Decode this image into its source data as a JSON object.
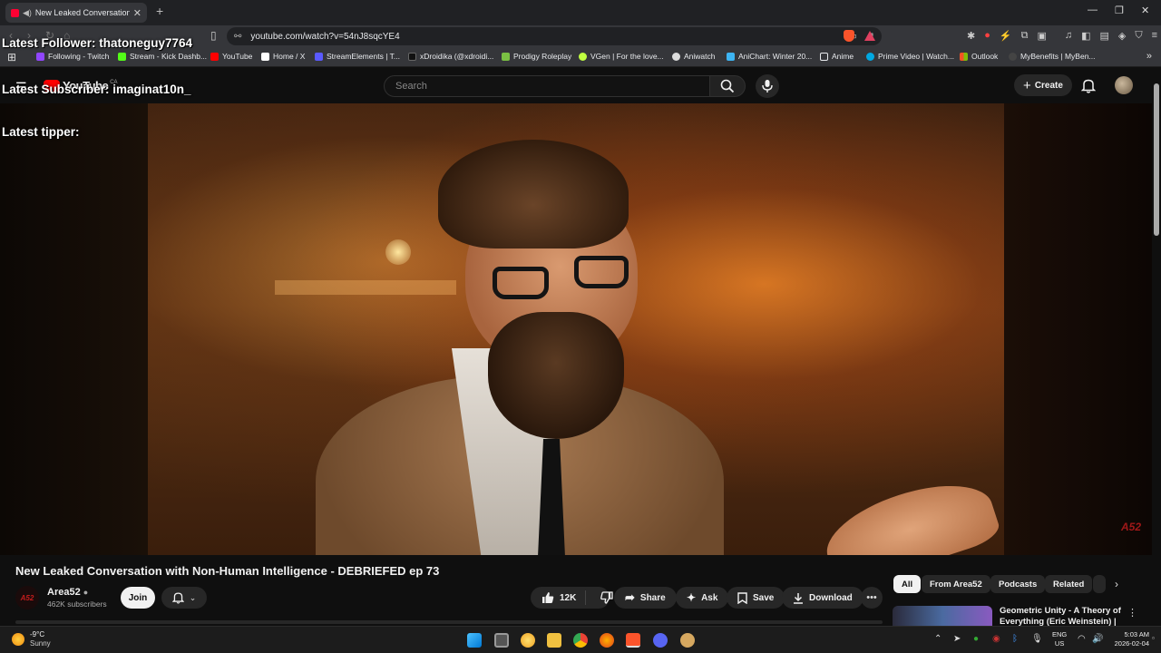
{
  "browser": {
    "tab_title": "New Leaked Conversation wi",
    "new_tab_symbol": "+",
    "url": "youtube.com/watch?v=54nJ8sqcYE4",
    "window_controls": [
      "—",
      "❐",
      "✕"
    ],
    "accent_color": "#fb542b"
  },
  "bookmarks": [
    {
      "label": "Following - Twitch",
      "color": "#9146ff"
    },
    {
      "label": "Stream - Kick Dashb...",
      "color": "#53fc18"
    },
    {
      "label": "YouTube",
      "color": "#ff0000"
    },
    {
      "label": "Home / X",
      "color": "#ffffff"
    },
    {
      "label": "StreamElements | T...",
      "color": "#5a5aff"
    },
    {
      "label": "xDroidika (@xdroidi...",
      "color": "#111111"
    },
    {
      "label": "Prodigy Roleplay",
      "color": "#7ac043"
    },
    {
      "label": "VGen | For the love...",
      "color": "#c0ff40"
    },
    {
      "label": "Aniwatch",
      "color": "#dddddd"
    },
    {
      "label": "AniChart: Winter 20...",
      "color": "#3db4f2"
    },
    {
      "label": "Anime",
      "color": "#e8eaed"
    },
    {
      "label": "Prime Video | Watch...",
      "color": "#00a8e1"
    },
    {
      "label": "Outlook",
      "color": "#f35325"
    },
    {
      "label": "MyBenefits | MyBen...",
      "color": "#e8eaed"
    }
  ],
  "overlay": {
    "follower": "Latest Follower: thatoneguy7764",
    "subscriber": "Latest Subscriber: imaginat10n_",
    "tipper": "Latest tipper:"
  },
  "youtube": {
    "logo_text": "YouTube",
    "country": "CA",
    "search_placeholder": "Search",
    "create_label": "Create",
    "watermark": "A52"
  },
  "video": {
    "title": "New Leaked Conversation with Non-Human Intelligence - DEBRIEFED ep 73",
    "channel": "Area52",
    "channel_avatar_text": "A52",
    "subscribers": "462K subscribers",
    "join_label": "Join",
    "likes": "12K",
    "share_label": "Share",
    "ask_label": "Ask",
    "save_label": "Save",
    "download_label": "Download"
  },
  "chips": [
    "All",
    "From Area52",
    "Podcasts",
    "Related"
  ],
  "recommendation": {
    "title": "Geometric Unity - A Theory of Everything (Eric Weinstein) | AI"
  },
  "taskbar": {
    "temperature": "-9°C",
    "condition": "Sunny",
    "lang_top": "ENG",
    "lang_bottom": "US",
    "time": "5:03 AM",
    "date": "2026-02-04"
  }
}
